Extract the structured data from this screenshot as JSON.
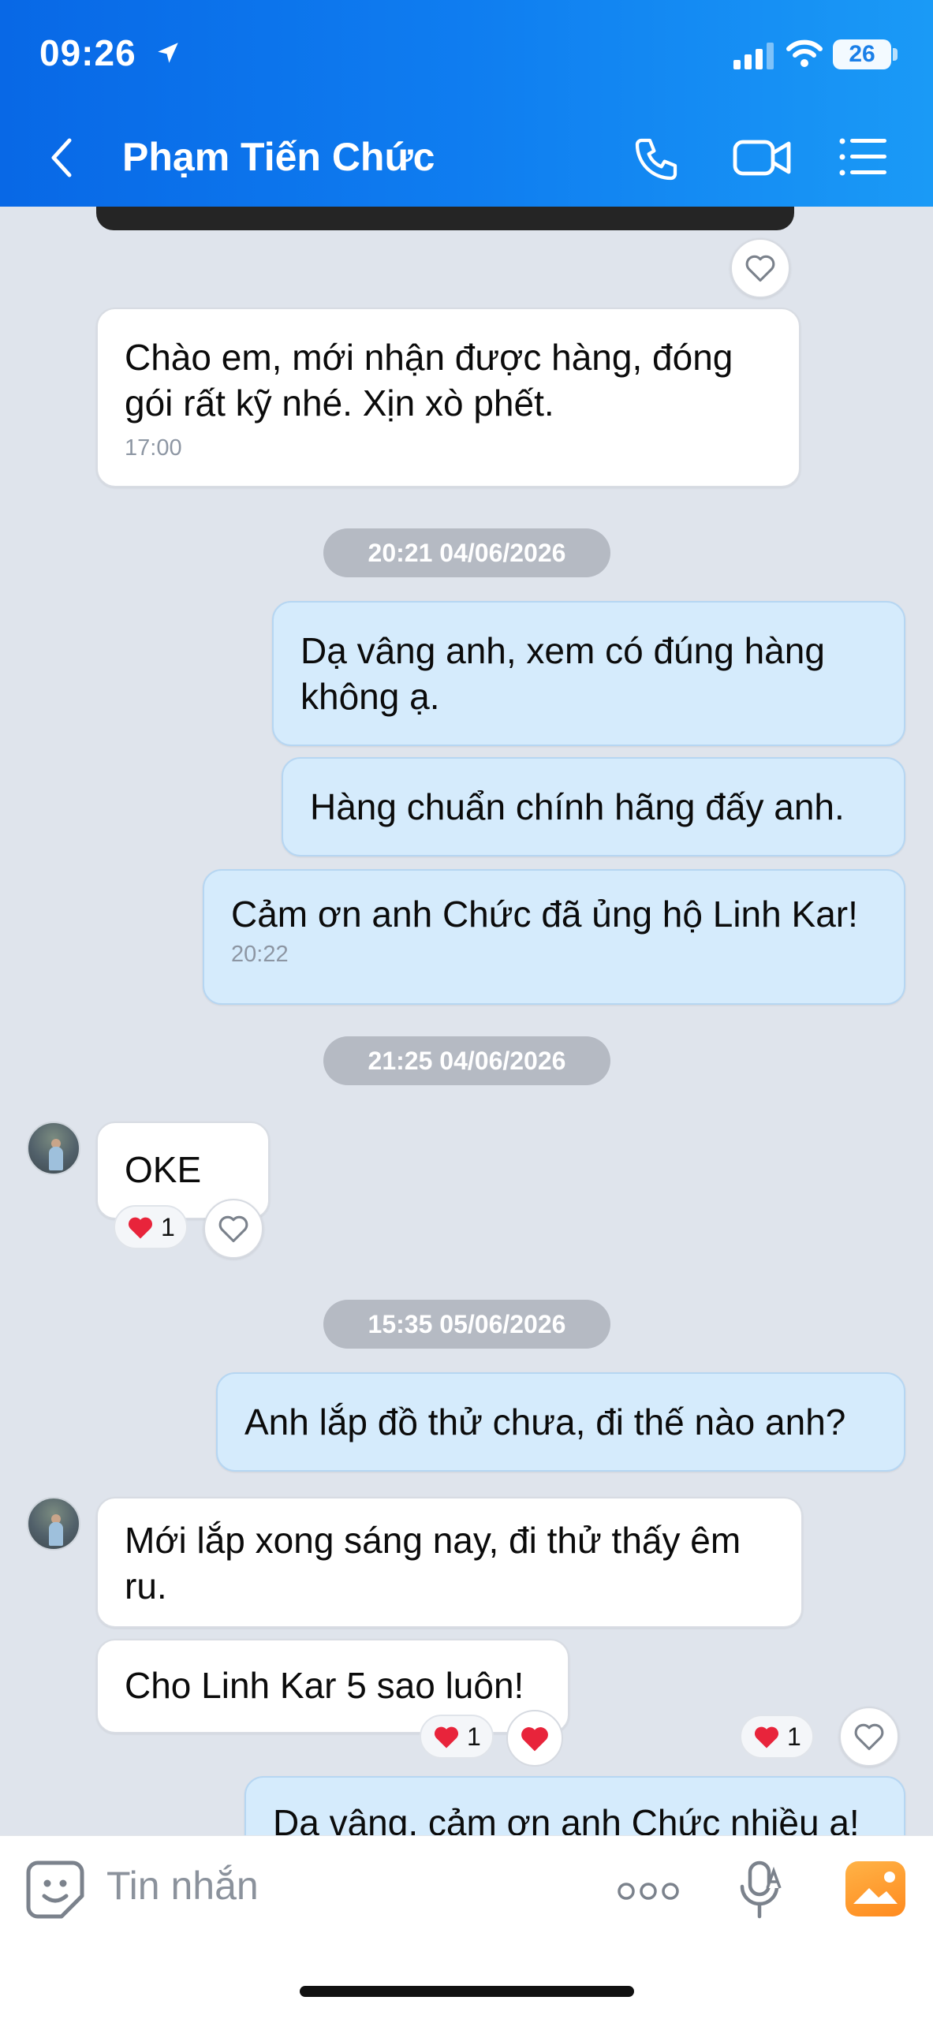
{
  "status_bar": {
    "time": "09:26",
    "battery": "26"
  },
  "header": {
    "contact_name": "Phạm Tiến Chức"
  },
  "messages": {
    "m1": {
      "text": "Chào em, mới nhận được hàng, đóng gói rất kỹ nhé. Xịn xò phết.",
      "time": "17:00"
    },
    "stamp1": "20:21 04/06/2026",
    "m2": {
      "text": "Dạ vâng anh, xem có đúng hàng không ạ."
    },
    "m3": {
      "text": "Hàng chuẩn chính hãng đấy anh."
    },
    "m4": {
      "text": "Cảm ơn anh Chức đã ủng hộ Linh Kar!",
      "time": "20:22"
    },
    "stamp2": "21:25 04/06/2026",
    "m5": {
      "text": "OKE",
      "reaction_count": "1"
    },
    "stamp3": "15:35 05/06/2026",
    "m6": {
      "text": "Anh lắp đồ thử chưa, đi thế nào anh?"
    },
    "m7": {
      "text": "Mới lắp xong sáng nay, đi thử thấy êm ru."
    },
    "m8": {
      "text": "Cho Linh Kar 5 sao luôn!",
      "reaction_count": "1"
    },
    "m9": {
      "text": "Dạ vâng, cảm ơn anh Chức nhiều ạ!",
      "reaction_count": "1"
    }
  },
  "input": {
    "placeholder": "Tin nhắn"
  },
  "colors": {
    "header_start": "#0868e6",
    "header_end": "#1a9af6",
    "out_bubble": "#d5ebfc",
    "heart": "#e8243b"
  },
  "icons": [
    "location-arrow-icon",
    "signal-icon",
    "wifi-icon",
    "back-icon",
    "phone-icon",
    "video-call-icon",
    "menu-list-icon",
    "heart-icon",
    "sticker-icon",
    "more-icon",
    "mic-icon",
    "image-icon"
  ]
}
